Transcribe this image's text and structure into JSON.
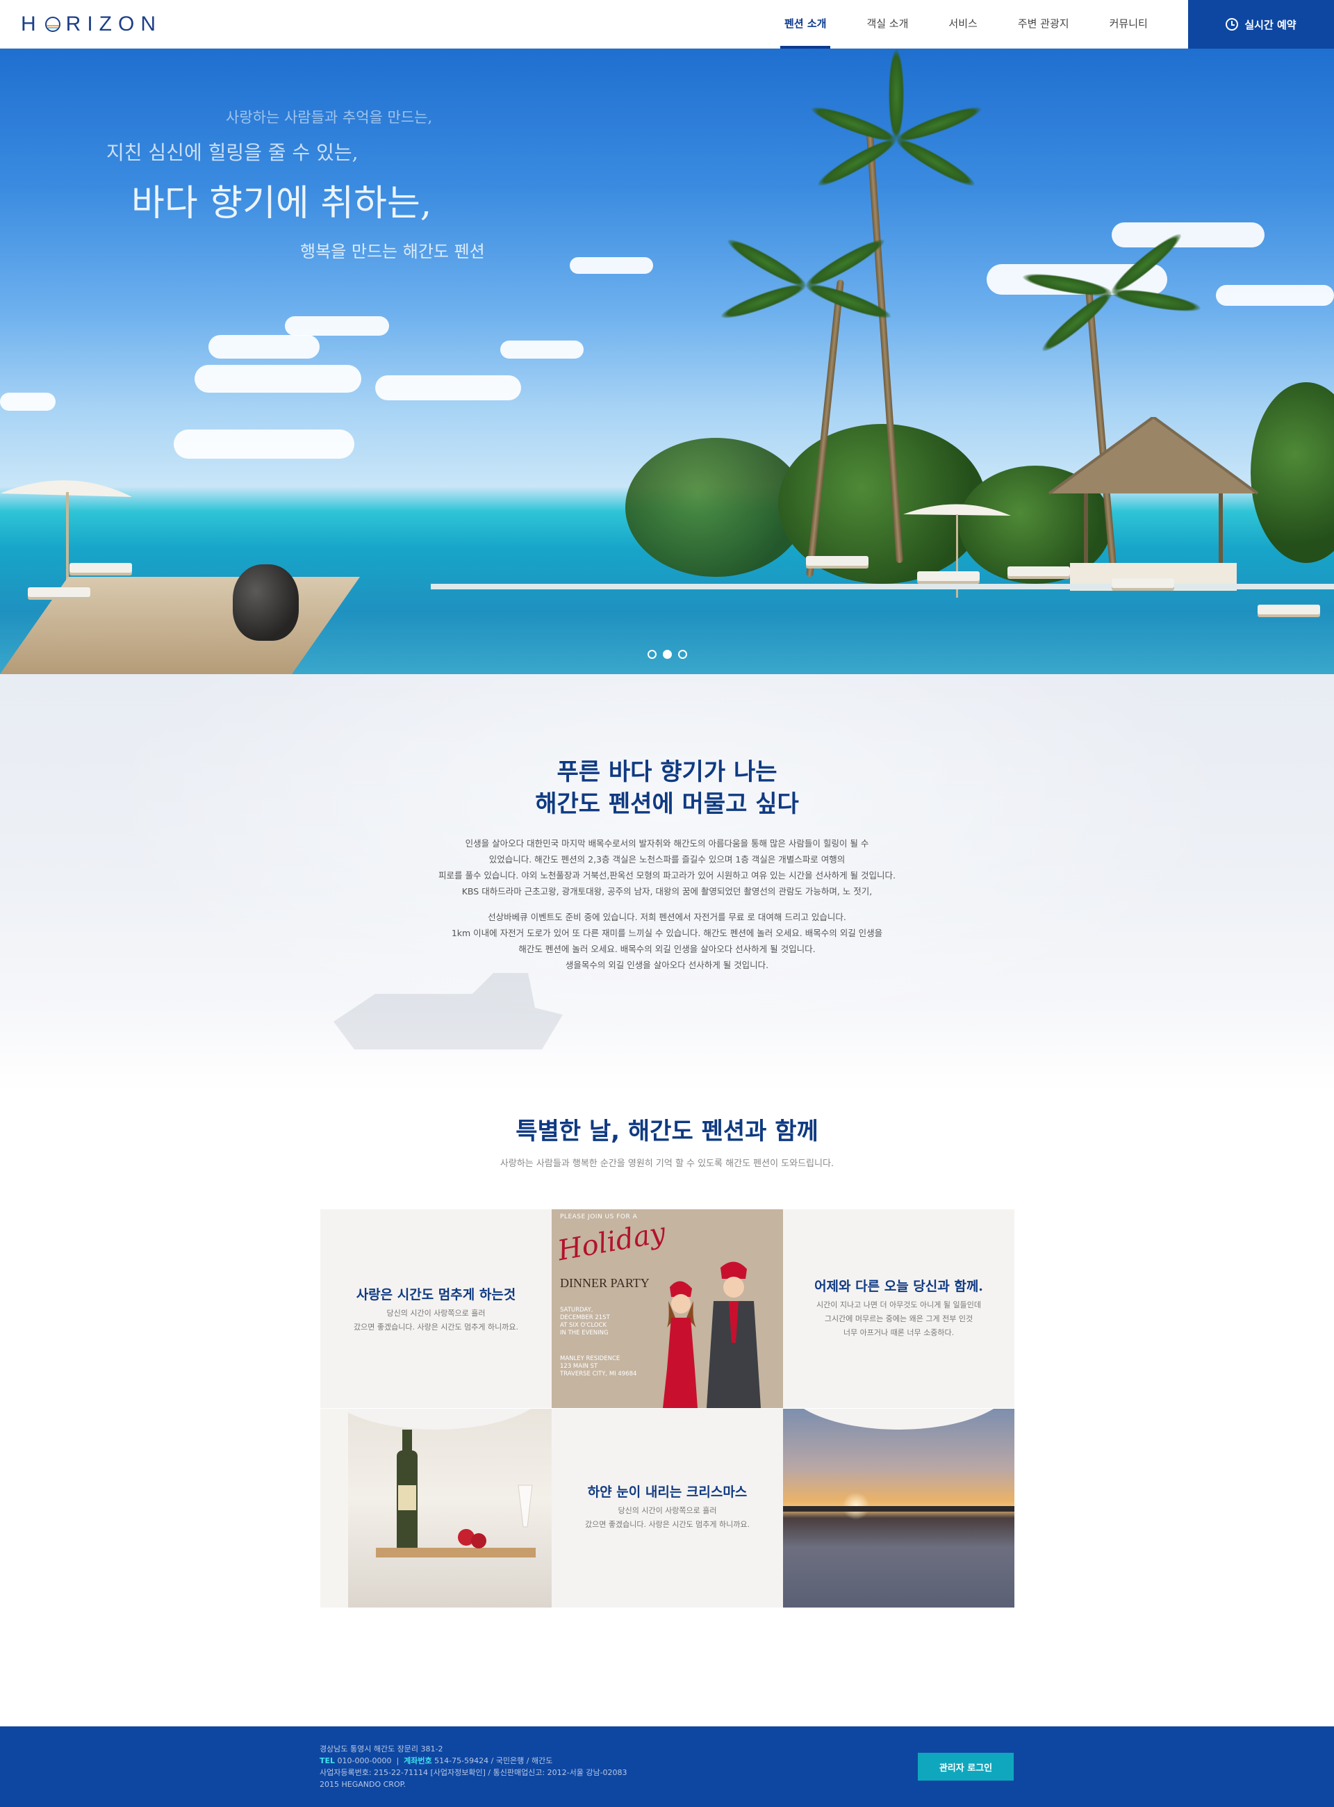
{
  "header": {
    "logo": "HORIZON",
    "nav": [
      "펜션 소개",
      "객실 소개",
      "서비스",
      "주변 관광지",
      "커뮤니티"
    ],
    "active_nav_index": 0,
    "reserve_label": "실시간 예약"
  },
  "hero": {
    "line1": "사랑하는 사람들과 추억을 만드는,",
    "line2": "지친 심신에 힐링을 줄 수 있는,",
    "line3": "바다 향기에 취하는,",
    "line4": "행복을 만드는 해간도 펜션",
    "slides_total": 3,
    "active_slide_index": 1
  },
  "intro": {
    "title_line1": "푸른 바다 향기가 나는",
    "title_line2": "해간도 펜션에 머물고 싶다",
    "para1": [
      "인생을 살아오다 대한민국 마지막 배목수로서의 발자취와 해간도의 아름다움을 통해 많은 사람들이 힐링이 될 수",
      "있었습니다.  해간도 펜션의 2,3층 객실은 노천스파를 즐길수 있으며 1층 객실은 개별스파로 여행의",
      "피로를 풀수 있습니다.  야외 노천풀장과 거북선,판옥선 모형의 파고라가 있어 시원하고  여유 있는 시간을 선사하게 될 것입니다.",
      "KBS 대하드라마 근초고왕, 광개토대왕, 공주의 남자, 대왕의 꿈에 촬영되었던 촬영선의 관람도 가능하며, 노 젓기,"
    ],
    "para2": [
      "선상바베큐 이벤트도 준비 중에 있습니다.  저희 펜션에서 자전거를 무료 로 대여해 드리고 있습니다.",
      "1km 이내에 자전거 도로가 있어 또 다른 재미를 느끼실 수 있습니다.  해간도 펜션에 놀러 오세요. 배목수의 외길 인생을",
      "해간도 펜션에 놀러 오세요. 배목수의 외길 인생을 살아오다 선사하게 될 것입니다.",
      "생을목수의 외길 인생을 살아오다 선사하게 될 것입니다."
    ]
  },
  "special": {
    "title": "특별한 날, 해간도 펜션과 함께",
    "subtitle": "사랑하는 사람들과 행복한 순간을 영원히 기억 할 수 있도록 해간도 펜션이 도와드립니다.",
    "card1": {
      "title": "사랑은 시간도 멈추게 하는것",
      "body": [
        "당신의 시간이 사랑쪽으로 흘러",
        "갔으면 좋겠습니다. 사랑은 시간도 멈추게 하니까요."
      ]
    },
    "card2": {
      "title": "어제와 다른 오늘 당신과 함께.",
      "body": [
        "시간이 지나고 나면 더 아무것도 아니게 될 일들인데",
        "그시간에 머무르는 중에는 왜은 그게 전부 인것",
        "너무 아프거나 때론 너무 소중하다."
      ]
    },
    "card3": {
      "title": "하얀 눈이 내리는 크리스마스",
      "body": [
        "당신의 시간이 사랑쪽으로 흘러",
        "갔으면 좋겠습니다. 사랑은 시간도 멈추게 하니까요."
      ]
    },
    "invitation": {
      "small": "PLEASE JOIN US FOR A",
      "script": "Holiday",
      "dinner": "DINNER PARTY",
      "when": "SATURDAY,\nDECEMBER 21ST\nAT SIX O'CLOCK\nIN THE EVENING",
      "where": "MANLEY RESIDENCE\n123 MAIN ST\nTRAVERSE CITY, MI 49684"
    }
  },
  "footer": {
    "address": "경상남도 통영시 해간도 장문리 381-2",
    "tel_label": "TEL",
    "tel": "010-000-0000",
    "account_label": "계좌번호",
    "account": "514-75-59424 / 국민은행 / 해간도",
    "business": "사업자등록번호: 215-22-71114 [사업자정보확인] / 통신판매업신고: 2012-서울 강남-02083",
    "copyright": "2015 HEGANDO CROP.",
    "admin_label": "관리자 로그인"
  },
  "colors": {
    "brand_blue": "#0e47a1",
    "title_navy": "#0f3a82",
    "footer_accent": "#3fe0f0",
    "admin_button": "#0fa7bd"
  }
}
